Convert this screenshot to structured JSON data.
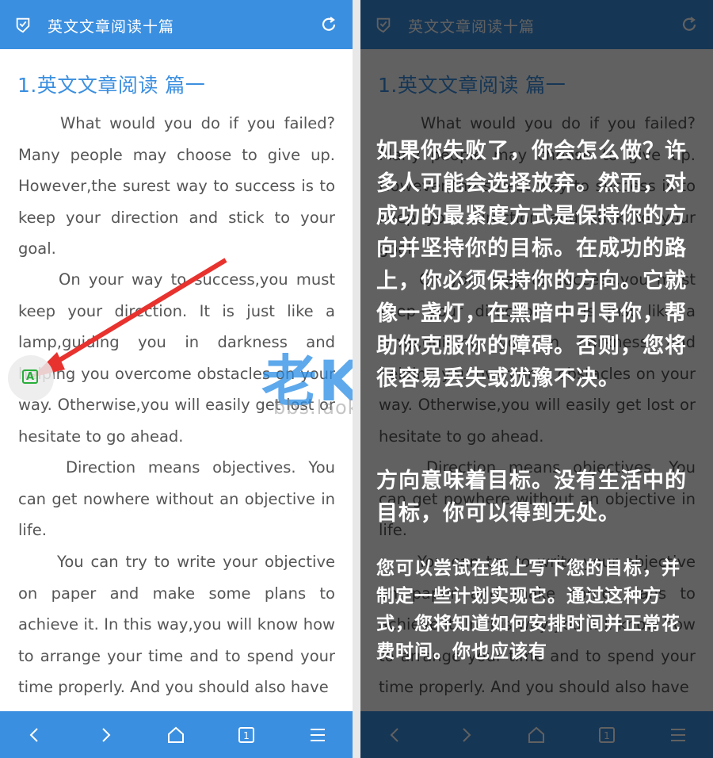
{
  "topbar": {
    "title": "英文文章阅读十篇",
    "icon_left": "shield-check-icon",
    "icon_right": "refresh-icon"
  },
  "article": {
    "heading": "1.英文文章阅读 篇一",
    "paragraphs": [
      "What would you do if you failed? Many people may choose to give up. However,the surest way to success is to keep your direction and stick to your goal.",
      "On your way to success,you must keep your direction. It is just like a lamp,guiding you in darkness and helping you overcome obstacles on your way. Otherwise,you will easily get lost or hesitate to go ahead.",
      "Direction means objectives. You can get nowhere without an objective in life.",
      "You can try to write your objective on paper and make some plans to achieve it. In this way,you will know how to arrange your time and to spend your time properly. And you should also have"
    ]
  },
  "translation": {
    "block1": "如果你失败了，你会怎么做？许多人可能会选择放弃。然而，对成功的最紧度方式是保持你的方向并坚持你的目标。在成功的路上，你必须保持你的方向。它就像一盏灯，在黑暗中引导你，帮助你克服你的障碍。否则，您将很容易丢失或犹豫不决。",
    "block2": "方向意味着目标。没有生活中的目标，你可以得到无处。",
    "block3": "您可以尝试在纸上写下您的目标，并制定一些计划实现它。通过这种方式，您将知道如何安排时间并正常花费时间。你也应该有"
  },
  "floating_button": {
    "label": "A",
    "icon": "translate-icon"
  },
  "watermark": {
    "text": "老K资源网",
    "url": "bbs.laok.cc"
  },
  "bottombar": {
    "icons": [
      "back-icon",
      "forward-icon",
      "home-icon",
      "tabs-icon",
      "menu-icon"
    ],
    "tabs_count": "1"
  },
  "colors": {
    "accent": "#3b8fe0",
    "text": "#555555",
    "fab_green": "#27ae3a",
    "arrow": "#e8322e"
  }
}
